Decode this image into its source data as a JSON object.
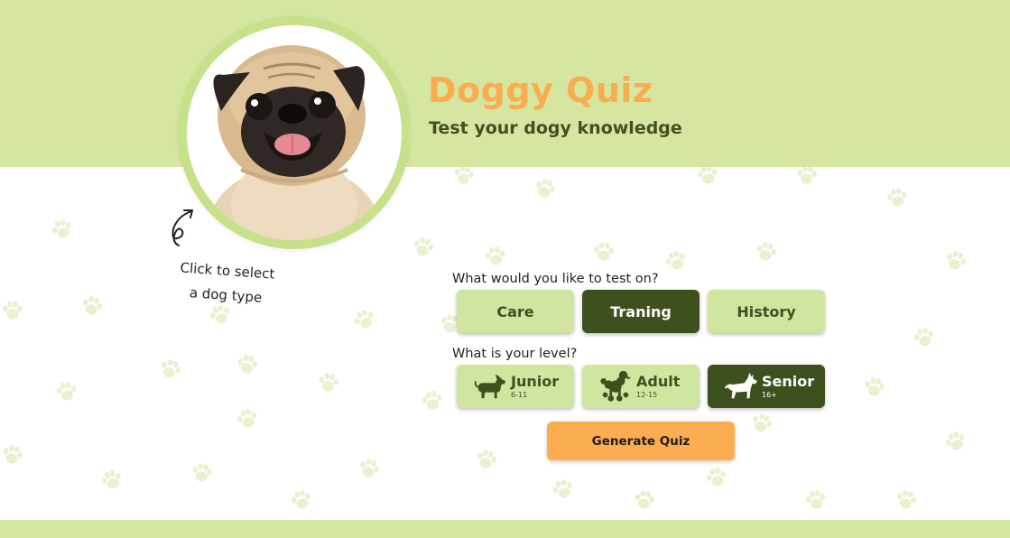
{
  "header": {
    "title": "Doggy Quiz",
    "subtitle": "Test your dogy knowledge"
  },
  "avatar": {
    "icon": "pug-photo"
  },
  "hint": {
    "line1": "Click to select",
    "line2": "a dog type",
    "icon": "curly-arrow-icon"
  },
  "topics": {
    "question": "What would you like to test on?",
    "options": [
      {
        "label": "Care",
        "selected": false
      },
      {
        "label": "Traning",
        "selected": true
      },
      {
        "label": "History",
        "selected": false
      }
    ]
  },
  "levels": {
    "question": "What is your level?",
    "options": [
      {
        "label": "Junior",
        "age": "6-11",
        "icon": "dachshund-icon",
        "selected": false
      },
      {
        "label": "Adult",
        "age": "12-15",
        "icon": "poodle-icon",
        "selected": false
      },
      {
        "label": "Senior",
        "age": "16+",
        "icon": "shepherd-dog-icon",
        "selected": true
      }
    ]
  },
  "actions": {
    "generate_label": "Generate Quiz"
  },
  "colors": {
    "band": "#d4e6a0",
    "accent": "#f9ad4e",
    "dark_green": "#3f501f",
    "light_green": "#d0e5a0",
    "paw": "#e6f0cc"
  }
}
